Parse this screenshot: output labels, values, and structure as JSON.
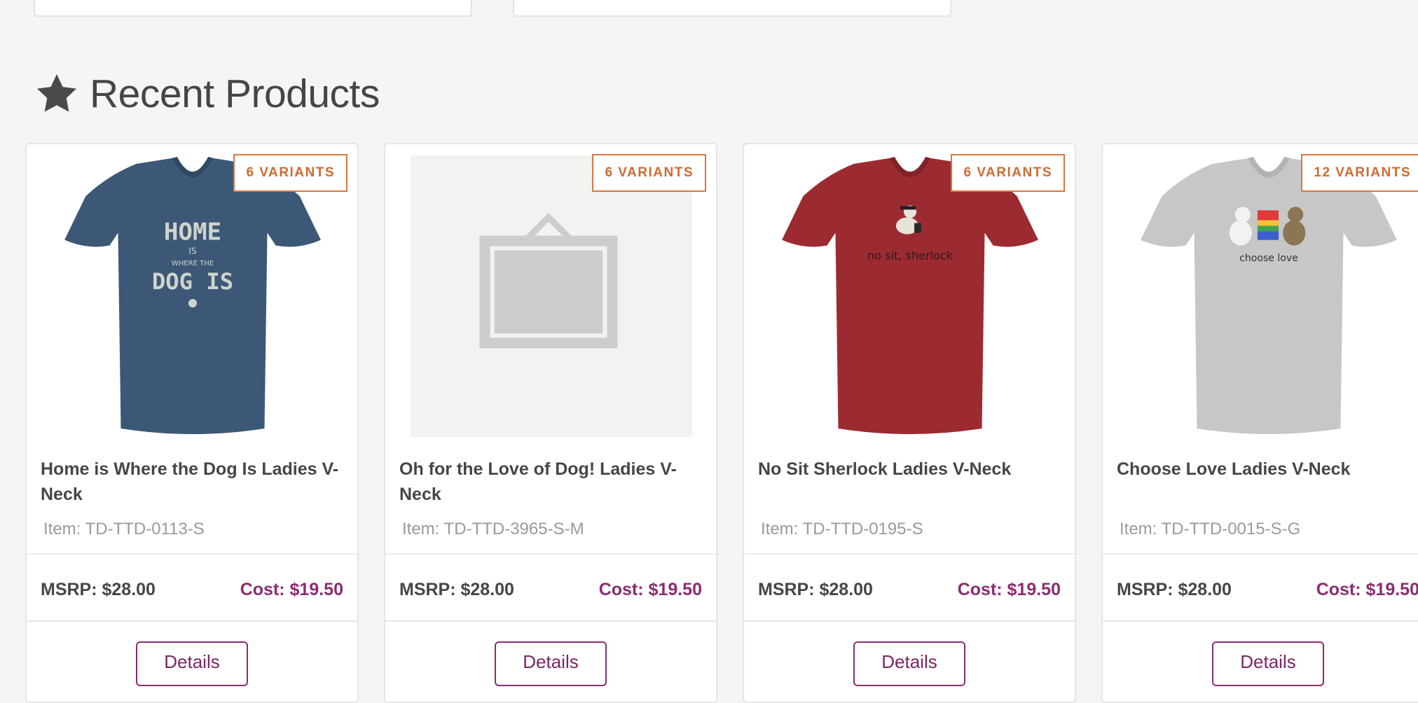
{
  "section": {
    "title": "Recent Products",
    "icon": "star-icon"
  },
  "colors": {
    "badge": "#cf6a30",
    "accent": "#8b2c71"
  },
  "products": [
    {
      "title": "Home is Where the Dog Is Ladies V-Neck",
      "sku": "Item: TD-TTD-0113-S",
      "badge": "6 VARIANTS",
      "msrp": "MSRP: $28.00",
      "cost": "Cost: $19.50",
      "details": "Details",
      "shirt_color": "#3c5876",
      "shirt_text": "HOME IS DOG IS"
    },
    {
      "title": "Oh for the Love of Dog! Ladies V-Neck",
      "sku": "Item: TD-TTD-3965-S-M",
      "badge": "6 VARIANTS",
      "msrp": "MSRP: $28.00",
      "cost": "Cost: $19.50",
      "details": "Details",
      "image": "placeholder-icon"
    },
    {
      "title": "No Sit Sherlock Ladies V-Neck",
      "sku": "Item: TD-TTD-0195-S",
      "badge": "6 VARIANTS",
      "msrp": "MSRP: $28.00",
      "cost": "Cost: $19.50",
      "details": "Details",
      "shirt_color": "#9c2b31",
      "shirt_text": "no sit, sherlock"
    },
    {
      "title": "Choose Love Ladies V-Neck",
      "sku": "Item: TD-TTD-0015-S-G",
      "badge": "12 VARIANTS",
      "msrp": "MSRP: $28.00",
      "cost": "Cost: $19.50",
      "details": "Details",
      "shirt_color": "#c7c7c7",
      "shirt_text": "choose love"
    }
  ]
}
